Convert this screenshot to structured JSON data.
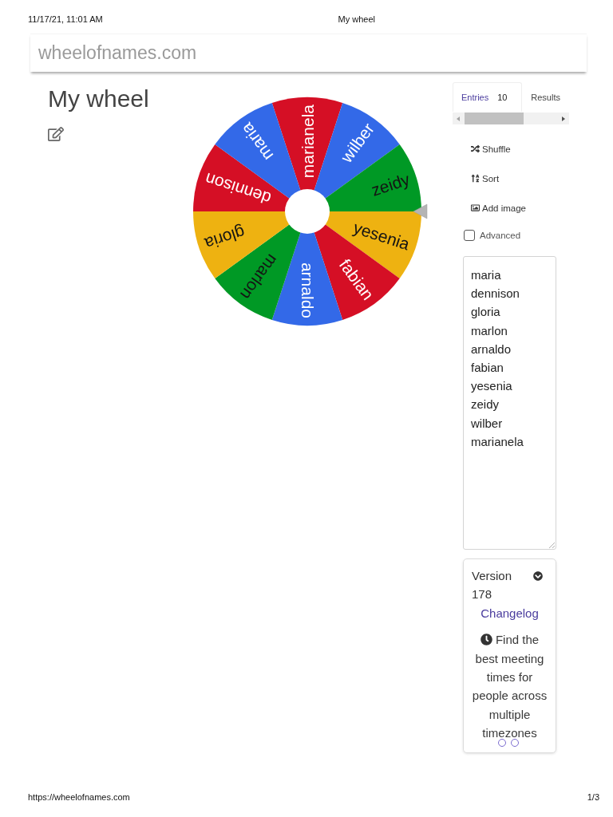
{
  "print_header": {
    "date": "11/17/21, 11:01 AM",
    "title": "My wheel"
  },
  "navbar": {
    "brand": "wheelofnames.com"
  },
  "wheel_title": "My wheel",
  "wheel": {
    "segments": [
      {
        "label": "marianela",
        "color": "#d50f25"
      },
      {
        "label": "wilber",
        "color": "#3369e8"
      },
      {
        "label": "zeidy",
        "color": "#009925"
      },
      {
        "label": "yesenia",
        "color": "#eeb211"
      },
      {
        "label": "fabian",
        "color": "#d50f25"
      },
      {
        "label": "arnaldo",
        "color": "#3369e8"
      },
      {
        "label": "marlon",
        "color": "#009925"
      },
      {
        "label": "gloria",
        "color": "#eeb211"
      },
      {
        "label": "dennison",
        "color": "#d50f25"
      },
      {
        "label": "maria",
        "color": "#3369e8"
      }
    ]
  },
  "tabs": [
    {
      "label": "Entries",
      "count": "10",
      "selected": true
    },
    {
      "label": "Results",
      "selected": false
    }
  ],
  "actions": [
    "Shuffle",
    "Sort",
    "Add image"
  ],
  "advanced": {
    "label": "Advanced",
    "checked": false
  },
  "entries": [
    "maria",
    "dennison",
    "gloria",
    "marlon",
    "arnaldo",
    "fabian",
    "yesenia",
    "zeidy",
    "wilber",
    "marianela"
  ],
  "version_card": {
    "label": "Version",
    "number": "178",
    "link": "Changelog",
    "promo": "Find the best meeting times for people across multiple timezones"
  },
  "print_footer": {
    "url": "https://wheelofnames.com",
    "page": "1/3"
  }
}
